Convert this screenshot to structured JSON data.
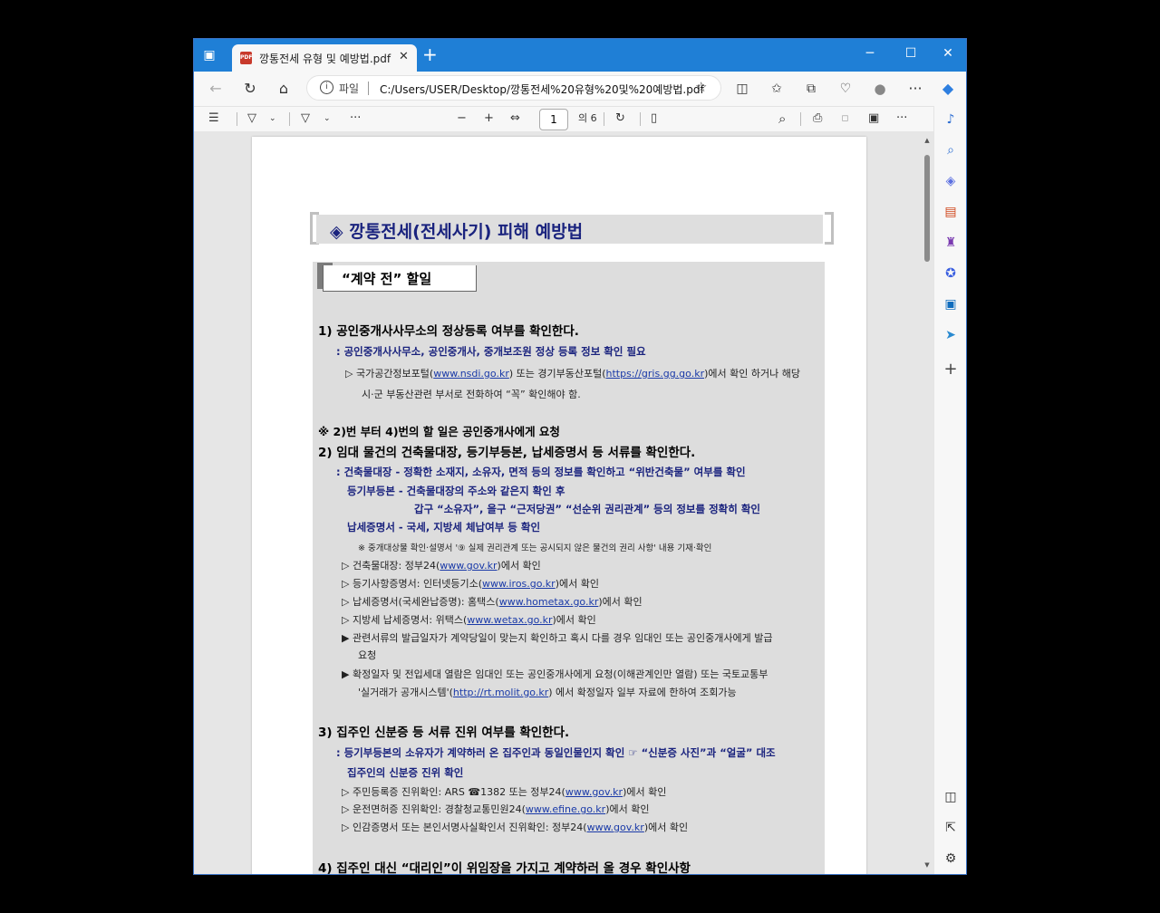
{
  "window": {
    "tab_title": "깡통전세 유형 및 예방법.pdf",
    "new_tab": "+",
    "minimize": "─",
    "maximize": "☐",
    "close": "✕"
  },
  "addressbar": {
    "back": "←",
    "refresh": "↻",
    "home": "⌂",
    "info": "i",
    "scheme_label": "파일",
    "url": "C:/Users/USER/Desktop/깡통전세%20유형%20및%20예방법.pdf",
    "favorite": "☆",
    "more": "···"
  },
  "pdf_toolbar": {
    "contents": "☰",
    "highlight": "▽",
    "draw": "▽",
    "more": "···",
    "zoom_out": "−",
    "zoom_in": "+",
    "fit": "⇔",
    "page": "1",
    "page_total": "의 6",
    "rotate": "↻",
    "page_view": "▯",
    "search": "⌕",
    "print": "⎙",
    "save": "▫",
    "save_as": "▣",
    "overflow": "···"
  },
  "sidepanel": {
    "icons": [
      "bell-icon",
      "search-icon",
      "shopping-icon",
      "tools-icon",
      "games-icon",
      "office-icon",
      "outlook-icon",
      "send-icon",
      "add-icon",
      "sidebar-icon",
      "external-icon",
      "settings-icon"
    ],
    "add": "+"
  },
  "document": {
    "title": "◈ 깡통전세(전세사기) 피해 예방법",
    "section_label": "“계약 전” 할일",
    "items": {
      "h1": "1) 공인중개사사무소의 정상등록 여부를 확인한다.",
      "b1": ": 공인중개사사무소, 공인중개사, 중개보조원 정상 등록 정보 확인 필요",
      "n1a_pre": "▷ 국가공간정보포털(",
      "n1a_link1": "www.nsdi.go.kr",
      "n1a_mid": ") 또는 경기부동산포털(",
      "n1a_link2": "https://gris.gg.go.kr",
      "n1a_post": ")에서 확인 하거나 해당",
      "n1b": "시·군 부동산관련 부서로 전화하여 “꼭” 확인해야 함.",
      "note2": "※ 2)번 부터 4)번의 할 일은 공인중개사에게 요청",
      "h2": "2) 임대 물건의 건축물대장, 등기부등본, 납세증명서 등 서류를 확인한다.",
      "b2a": ": 건축물대장 - 정확한 소재지, 소유자, 면적 등의 정보를 확인하고 “위반건축물” 여부를 확인",
      "b2b": "등기부등본 - 건축물대장의 주소와 같은지 확인 후",
      "b2c": "갑구 “소유자”, 을구 “근저당권” “선순위 권리관계” 등의 정보를 정확히 확인",
      "b2d": "납세증명서 -  국세, 지방세 체납여부 등 확인",
      "s2": "※ 중개대상물 확인·설명서 '⑨ 실제 권리관계 또는 공시되지 않은 물건의 권리 사항' 내용 기재·확인",
      "n2a_pre": "▷ 건축물대장: 정부24(",
      "n2a_link": "www.gov.kr",
      "n2a_post": ")에서 확인",
      "n2b_pre": "▷ 등기사항증명서: 인터넷등기소(",
      "n2b_link": "www.iros.go.kr",
      "n2b_post": ")에서 확인",
      "n2c_pre": "▷ 납세증명서(국세완납증명): 홈택스(",
      "n2c_link": "www.hometax.go.kr",
      "n2c_post": ")에서 확인",
      "n2d_pre": "▷ 지방세 납세증명서: 위택스(",
      "n2d_link": "www.wetax.go.kr",
      "n2d_post": ")에서 확인",
      "n2e1": "▶ 관련서류의 발급일자가 계약당일이 맞는지 확인하고 혹시 다를 경우 임대인 또는 공인중개사에게 발급",
      "n2e2": "요청",
      "n2f1": "▶ 확정일자 및 전입세대 열람은 임대인 또는 공인중개사에게 요청(이해관계인만 열람) 또는 국토교통부",
      "n2f2_pre": "'실거래가 공개시스템'(",
      "n2f2_link": "http://rt.molit.go.kr",
      "n2f2_post": ") 에서 확정일자 일부 자료에 한하여 조회가능",
      "h3": "3) 집주인 신분증 등 서류 진위 여부를 확인한다.",
      "b3a": ": 등기부등본의 소유자가 계약하러 온 집주인과 동일인물인지 확인 ☞ “신분증 사진”과 “얼굴” 대조",
      "b3b": "집주인의 신분증 진위 확인",
      "n3a_pre": "▷ 주민등록증 진위확인: ARS ☎1382 또는 정부24(",
      "n3a_link": "www.gov.kr",
      "n3a_post": ")에서 확인",
      "n3b_pre": "▷ 운전면허증 진위확인: 경찰청교통민원24(",
      "n3b_link": "www.efine.go.kr",
      "n3b_post": ")에서 확인",
      "n3c_pre": "▷ 인감증명서 또는 본인서명사실확인서 진위확인: 정부24(",
      "n3c_link": "www.gov.kr",
      "n3c_post": ")에서 확인",
      "h4": "4) 집주인 대신 “대리인”이 위임장을 가지고 계약하러 올 경우 확인사항"
    }
  }
}
